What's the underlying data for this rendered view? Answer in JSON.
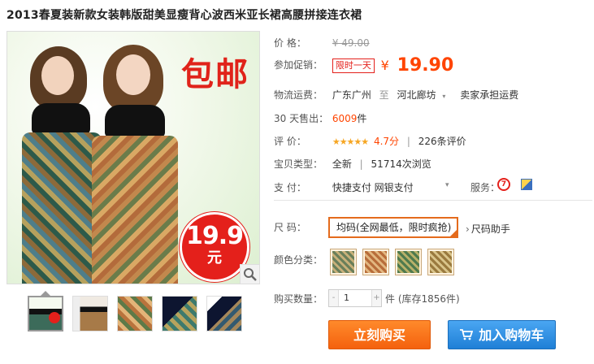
{
  "product": {
    "title": "2013春夏装新款女装韩版甜美显瘦背心波西米亚长裙高腰拼接连衣裙"
  },
  "image": {
    "badge_free": "包邮",
    "badge_price": "19.9",
    "badge_unit": "元",
    "thumbnail_count": 5
  },
  "info": {
    "price_label": "价 格：",
    "price_value": "¥ 49.00",
    "promo_label": "参加促销：",
    "promo_tag": "限时一天",
    "promo_yen": "¥",
    "promo_price": "19.90",
    "ship_label": "物流运费：",
    "ship_from": "广东广州",
    "ship_to_sep": "至",
    "ship_to": "河北廊坊",
    "ship_fee": "卖家承担运费",
    "sold_label": "30 天售出：",
    "sold_count": "6009",
    "sold_unit": "件",
    "rate_label": "评 价：",
    "rate_stars": "★★★★★",
    "rate_score": "4.7分",
    "rate_count": "226条评价",
    "type_label": "宝贝类型：",
    "type_value": "全新",
    "views": "51714次浏览",
    "pay_label": "支 付：",
    "pay_methods": "快捷支付 网银支付",
    "service_label": "服务：",
    "size_label": "尺 码：",
    "size_value": "均码(全网最低，限时疯抢)",
    "size_help": "尺码助手",
    "color_label": "颜色分类：",
    "qty_label": "购买数量：",
    "qty_value": "1",
    "stock_text": "件 (库存1856件)",
    "buy_label": "立刻购买",
    "cart_label": "加入购物车"
  },
  "colors": {
    "accent": "#ff4400",
    "buy_button": "#f4610e",
    "cart_button": "#1f7fd6"
  }
}
